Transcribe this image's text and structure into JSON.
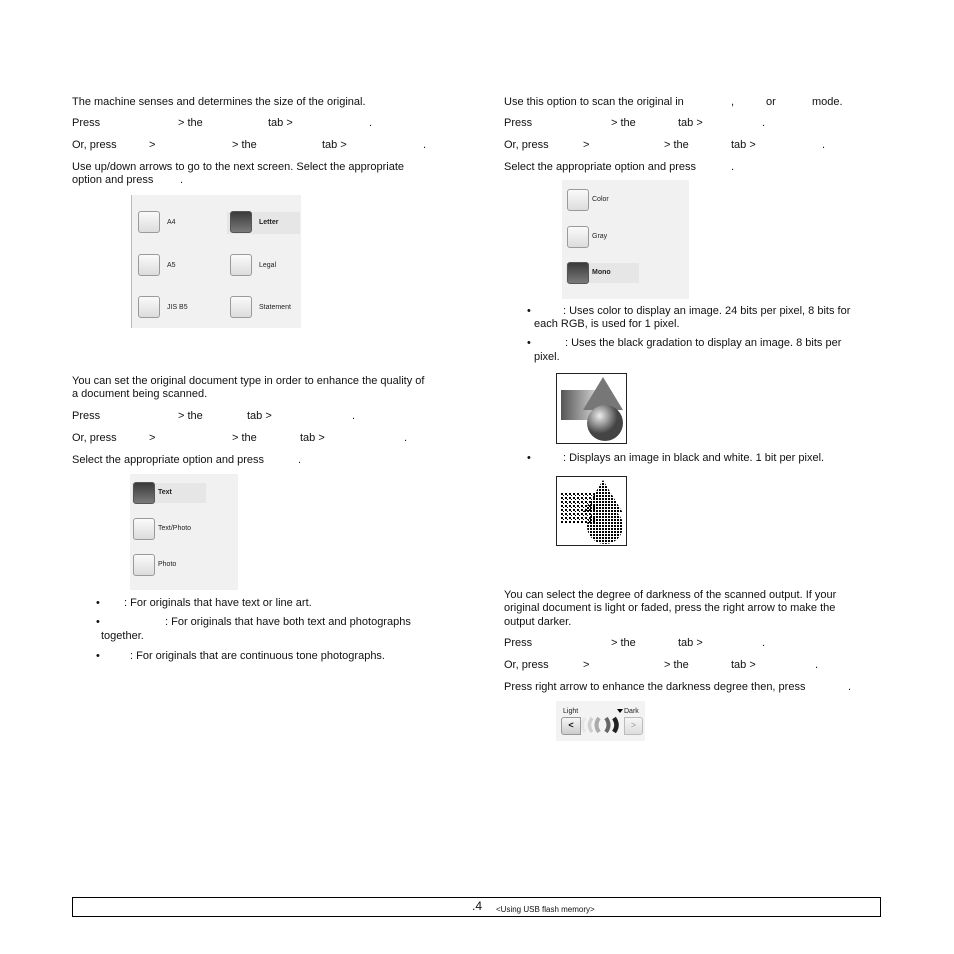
{
  "left": {
    "size": {
      "intro": "The machine senses and determines the size of the original.",
      "press": [
        "Press",
        "> the",
        "tab >",
        "."
      ],
      "or_press": [
        "Or, press",
        ">",
        "> the",
        "tab >",
        "."
      ],
      "instruction": [
        "Use up/down arrows to go to the next screen. Select the appropriate",
        "option and press",
        "."
      ],
      "options": [
        {
          "label": "A4",
          "selected": false
        },
        {
          "label": "Letter",
          "selected": true
        },
        {
          "label": "A5",
          "selected": false
        },
        {
          "label": "Legal",
          "selected": false
        },
        {
          "label": "JIS B5",
          "selected": false
        },
        {
          "label": "Statement",
          "selected": false
        }
      ]
    },
    "type": {
      "intro": [
        "You can set the original document type in order to enhance the quality of",
        "a document being scanned."
      ],
      "press": [
        "Press",
        "> the",
        "tab >",
        "."
      ],
      "or_press": [
        "Or, press",
        ">",
        "> the",
        "tab >",
        "."
      ],
      "instruction": [
        "Select the appropriate option and press",
        "."
      ],
      "options": [
        {
          "label": "Text",
          "selected": true
        },
        {
          "label": "Text/Photo",
          "selected": false
        },
        {
          "label": "Photo",
          "selected": false
        }
      ],
      "bullets": [
        ": For originals that have text or line art.",
        ": For originals that have both text and photographs",
        "together.",
        ": For originals that are continuous tone photographs."
      ],
      "bullet_mark": "•"
    }
  },
  "right": {
    "color": {
      "intro": [
        "Use this option to scan the original in",
        ",",
        "or",
        "mode."
      ],
      "press": [
        "Press",
        "> the",
        "tab >",
        "."
      ],
      "or_press": [
        "Or, press",
        ">",
        "> the",
        "tab >",
        "."
      ],
      "instruction": [
        "Select the appropriate option and press",
        "."
      ],
      "options": [
        {
          "label": "Color",
          "selected": false
        },
        {
          "label": "Gray",
          "selected": false
        },
        {
          "label": "Mono",
          "selected": true
        }
      ],
      "bullets": [
        ": Uses color to display an image. 24 bits per pixel, 8 bits for",
        "each RGB, is used for 1 pixel.",
        ": Uses the black gradation to display an image. 8 bits per",
        "pixel.",
        ": Displays an image in black and white. 1 bit per pixel."
      ],
      "bullet_mark": "•"
    },
    "darkness": {
      "intro": [
        "You can select the degree of darkness of the scanned output. If your",
        "original document is light or faded, press the right arrow to make the",
        "output darker."
      ],
      "press": [
        "Press",
        "> the",
        "tab >",
        "."
      ],
      "or_press": [
        "Or, press",
        ">",
        "> the",
        "tab >",
        "."
      ],
      "instruction": [
        "Press right arrow to enhance the darkness degree then, press",
        "."
      ],
      "slider": {
        "light_label": "Light",
        "dark_label": "Dark",
        "left_arrow": "<",
        "right_arrow": ">",
        "level": 5,
        "levels": 5
      }
    }
  },
  "footer": {
    "page": ".4",
    "chapter": "<Using USB flash memory>"
  }
}
